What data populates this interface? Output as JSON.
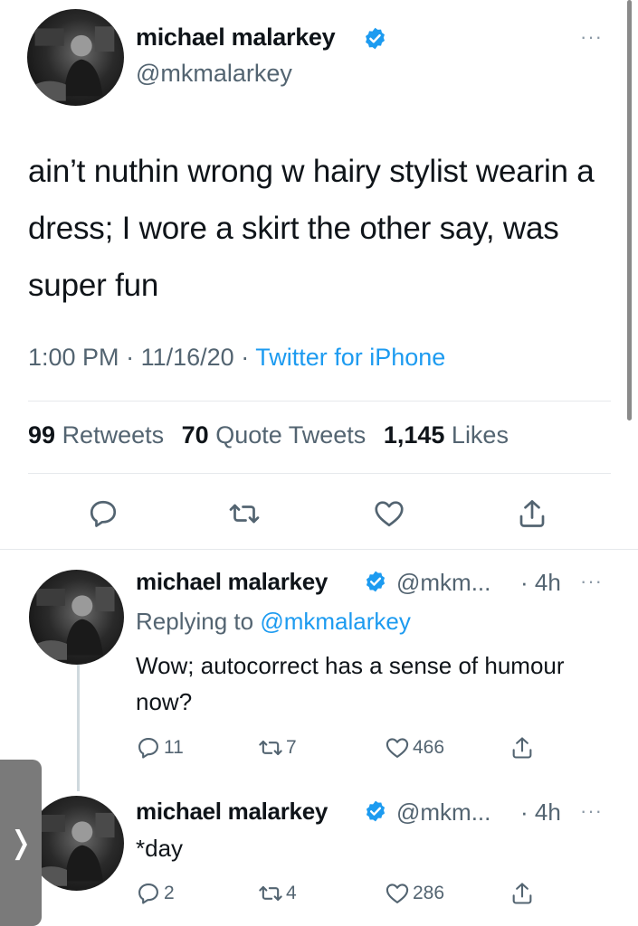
{
  "main_tweet": {
    "author_name": "michael malarkey",
    "author_handle": "@mkmalarkey",
    "text": "ain’t nuthin wrong w hairy stylist wearin a dress; I wore a skirt the other say, was super fun",
    "time": "1:00 PM",
    "date": "11/16/20",
    "source": "Twitter for iPhone",
    "sep": "·",
    "stats": {
      "retweets_count": "99",
      "retweets_label": "Retweets",
      "quotes_count": "70",
      "quotes_label": "Quote Tweets",
      "likes_count": "1,145",
      "likes_label": "Likes"
    }
  },
  "replies": [
    {
      "author_name": "michael malarkey",
      "author_handle": "@mkm...",
      "age": "· 4h",
      "replying_prefix": "Replying to",
      "replying_to": "@mkmalarkey",
      "text": "Wow; autocorrect has a sense of humour now?",
      "reply_count": "11",
      "retweet_count": "7",
      "like_count": "466"
    },
    {
      "author_name": "michael malarkey",
      "author_handle": "@mkm...",
      "age": "· 4h",
      "text": "*day",
      "reply_count": "2",
      "retweet_count": "4",
      "like_count": "286"
    }
  ],
  "more_glyph": "···",
  "side_tab_glyph": "❭",
  "colors": {
    "accent": "#1d9bf0",
    "text": "#0f1419",
    "secondary": "#536471",
    "divider": "#e6e9ec"
  }
}
